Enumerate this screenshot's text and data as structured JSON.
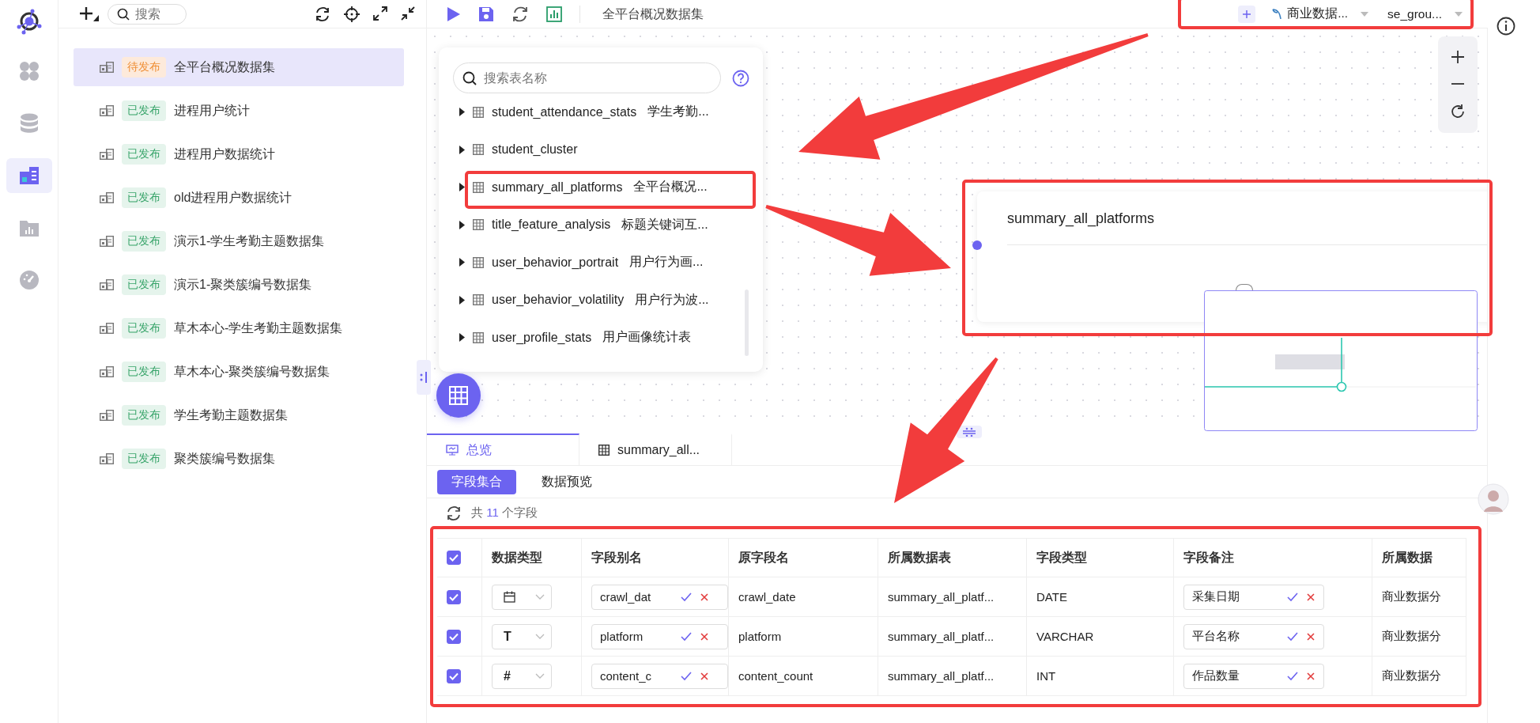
{
  "rail": {
    "items": [
      {
        "kind": "apps",
        "selected": false
      },
      {
        "kind": "database",
        "selected": false
      },
      {
        "kind": "dataset",
        "selected": true
      },
      {
        "kind": "report",
        "selected": false
      },
      {
        "kind": "dashboard",
        "selected": false
      }
    ]
  },
  "sidebar": {
    "search": {
      "placeholder": "搜索"
    },
    "items": [
      {
        "status": "待发布",
        "kind": "pending",
        "name": "全平台概况数据集",
        "selected": true
      },
      {
        "status": "已发布",
        "kind": "published",
        "name": "进程用户统计",
        "selected": false
      },
      {
        "status": "已发布",
        "kind": "published",
        "name": "进程用户数据统计",
        "selected": false
      },
      {
        "status": "已发布",
        "kind": "published",
        "name": "old进程用户数据统计",
        "selected": false
      },
      {
        "status": "已发布",
        "kind": "published",
        "name": "演示1-学生考勤主题数据集",
        "selected": false
      },
      {
        "status": "已发布",
        "kind": "published",
        "name": "演示1-聚类簇编号数据集",
        "selected": false
      },
      {
        "status": "已发布",
        "kind": "published",
        "name": "草木本心-学生考勤主题数据集",
        "selected": false
      },
      {
        "status": "已发布",
        "kind": "published",
        "name": "草木本心-聚类簇编号数据集",
        "selected": false
      },
      {
        "status": "已发布",
        "kind": "published",
        "name": "学生考勤主题数据集",
        "selected": false
      },
      {
        "status": "已发布",
        "kind": "published",
        "name": "聚类簇编号数据集",
        "selected": false
      }
    ]
  },
  "toolbar": {
    "title": "全平台概况数据集",
    "datasource": "商业数据...",
    "group": "se_grou..."
  },
  "table_picker": {
    "search": {
      "placeholder": "搜索表名称"
    },
    "tables": [
      {
        "name": "student_attendance_stats",
        "comment": "学生考勤..."
      },
      {
        "name": "student_cluster"
      },
      {
        "name": "summary_all_platforms",
        "comment": "全平台概况..."
      },
      {
        "name": "title_feature_analysis",
        "comment": "标题关键词互..."
      },
      {
        "name": "user_behavior_portrait",
        "comment": "用户行为画..."
      },
      {
        "name": "user_behavior_volatility",
        "comment": "用户行为波..."
      },
      {
        "name": "user_profile_stats",
        "comment": "用户画像统计表"
      }
    ]
  },
  "node": {
    "title": "summary_all_platforms"
  },
  "bottom": {
    "tabs": [
      {
        "label": "总览",
        "kind": "overview",
        "selected": true
      },
      {
        "label": "summary_all...",
        "kind": "table",
        "selected": false
      }
    ],
    "subtabs": [
      {
        "label": "字段集合",
        "selected": true
      },
      {
        "label": "数据预览",
        "selected": false
      }
    ],
    "count_prefix": "共",
    "count": "11",
    "count_suffix": "个字段"
  },
  "fields": {
    "all_checked": true,
    "columns": [
      "数据类型",
      "字段别名",
      "原字段名",
      "所属数据表",
      "字段类型",
      "字段备注",
      "所属数据"
    ],
    "rows": [
      {
        "checked": true,
        "type": {
          "kind": "date"
        },
        "alias": "crawl_dat",
        "original": "crawl_date",
        "table": "summary_all_platf...",
        "field_type": "DATE",
        "comment": "采集日期",
        "source": "商业数据分"
      },
      {
        "checked": true,
        "type": {
          "kind": "glyph",
          "glyph": "T"
        },
        "alias": "platform",
        "original": "platform",
        "table": "summary_all_platf...",
        "field_type": "VARCHAR",
        "comment": "平台名称",
        "source": "商业数据分"
      },
      {
        "checked": true,
        "type": {
          "kind": "glyph",
          "glyph": "#"
        },
        "alias": "content_c",
        "original": "content_count",
        "table": "summary_all_platf...",
        "field_type": "INT",
        "comment": "作品数量",
        "source": "商业数据分"
      }
    ]
  }
}
